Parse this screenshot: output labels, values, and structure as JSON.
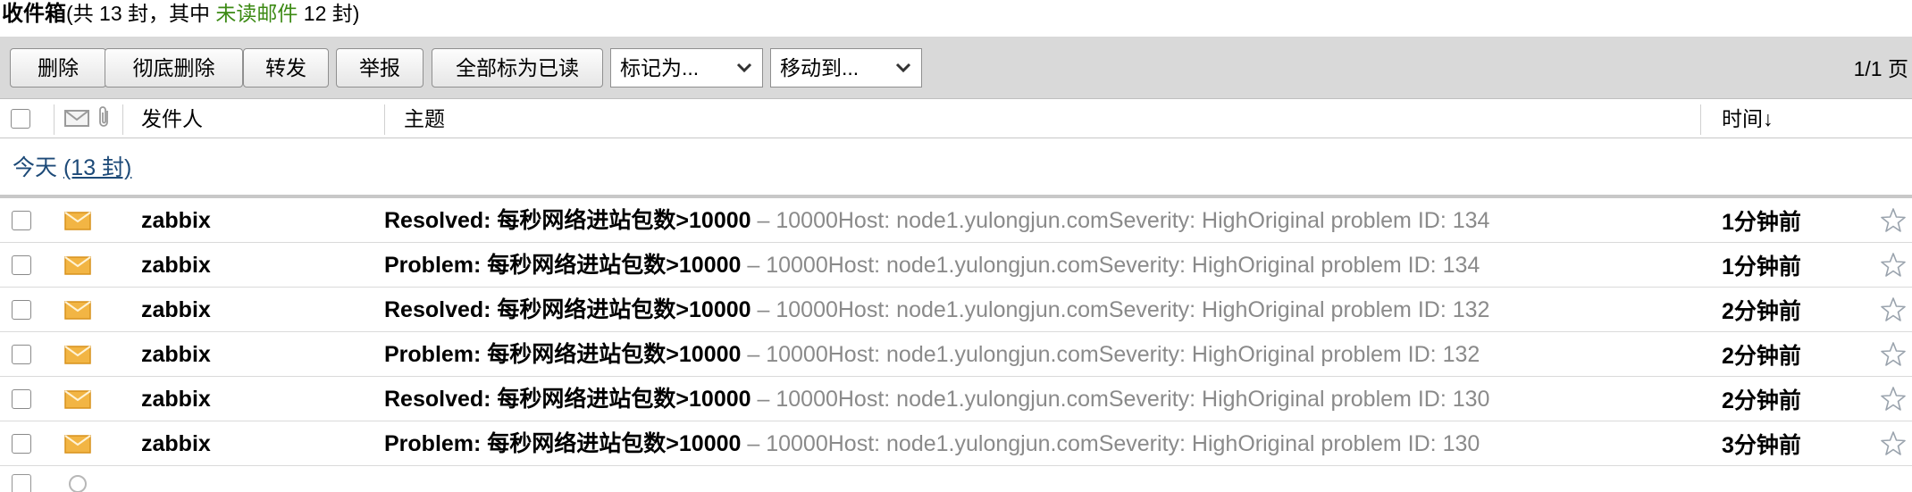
{
  "header": {
    "title": "收件箱",
    "count_prefix": "(共 13 封，其中 ",
    "unread_label": "未读邮件",
    "count_suffix": " 12 封)"
  },
  "toolbar": {
    "delete": "删除",
    "delete_permanently": "彻底删除",
    "forward": "转发",
    "report": "举报",
    "mark_all_read": "全部标为已读",
    "mark_as": "标记为...",
    "move_to": "移动到...",
    "page_indicator": "1/1 页"
  },
  "columns": {
    "sender": "发件人",
    "subject": "主题",
    "time": "时间↓"
  },
  "group": {
    "title": "今天",
    "count": "(13 封)"
  },
  "messages": [
    {
      "sender": "zabbix",
      "subject": "Resolved: 每秒网络进站包数>10000",
      "preview": " – 10000Host: node1.yulongjun.comSeverity: HighOriginal problem ID: 134",
      "time": "1分钟前"
    },
    {
      "sender": "zabbix",
      "subject": "Problem: 每秒网络进站包数>10000",
      "preview": " – 10000Host: node1.yulongjun.comSeverity: HighOriginal problem ID: 134",
      "time": "1分钟前"
    },
    {
      "sender": "zabbix",
      "subject": "Resolved: 每秒网络进站包数>10000",
      "preview": " – 10000Host: node1.yulongjun.comSeverity: HighOriginal problem ID: 132",
      "time": "2分钟前"
    },
    {
      "sender": "zabbix",
      "subject": "Problem: 每秒网络进站包数>10000",
      "preview": " – 10000Host: node1.yulongjun.comSeverity: HighOriginal problem ID: 132",
      "time": "2分钟前"
    },
    {
      "sender": "zabbix",
      "subject": "Resolved: 每秒网络进站包数>10000",
      "preview": " – 10000Host: node1.yulongjun.comSeverity: HighOriginal problem ID: 130",
      "time": "2分钟前"
    },
    {
      "sender": "zabbix",
      "subject": "Problem: 每秒网络进站包数>10000",
      "preview": " – 10000Host: node1.yulongjun.comSeverity: HighOriginal problem ID: 130",
      "time": "3分钟前"
    }
  ],
  "colors": {
    "unread_green": "#3c8a14",
    "link_blue": "#1d4a78",
    "toolbar_bg": "#d9d9d9",
    "envelope": "#f2b544",
    "preview_gray": "#8a8a8a"
  },
  "icons": [
    "checkbox",
    "envelope-icon",
    "attachment-icon",
    "star-icon",
    "chevron-down-icon"
  ]
}
